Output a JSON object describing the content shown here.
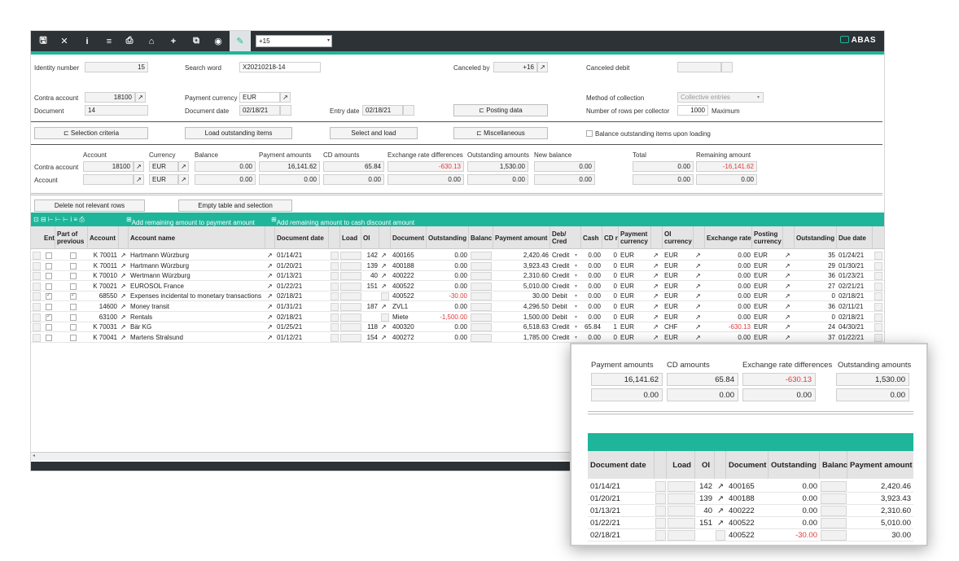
{
  "toolbar": {
    "buttons": [
      {
        "name": "save-icon",
        "glyph": "🖫"
      },
      {
        "name": "close-icon",
        "glyph": "✕"
      },
      {
        "name": "info-icon",
        "glyph": "i"
      },
      {
        "name": "list-icon",
        "glyph": "≡"
      },
      {
        "name": "print-icon",
        "glyph": "⎙"
      },
      {
        "name": "home-icon",
        "glyph": "⌂"
      },
      {
        "name": "add-icon",
        "glyph": "+"
      },
      {
        "name": "copy-icon",
        "glyph": "⧉"
      },
      {
        "name": "view-icon",
        "glyph": "◉"
      },
      {
        "name": "edit-icon",
        "glyph": "✎"
      }
    ],
    "select_value": "+15",
    "brand": "ABAS"
  },
  "header": {
    "identity_label": "Identity number",
    "identity_value": "15",
    "search_label": "Search word",
    "search_value": "X20210218-14",
    "canceled_by_label": "Canceled by",
    "canceled_by_value": "+16",
    "canceled_debit_label": "Canceled debit",
    "contra_label": "Contra account",
    "contra_value": "18100",
    "currency_label": "Payment currency",
    "currency_value": "EUR",
    "method_label": "Method of collection",
    "method_value": "Collective entries",
    "document_label": "Document",
    "document_value": "14",
    "docdate_label": "Document date",
    "docdate_value": "02/18/21",
    "entrydate_label": "Entry date",
    "entrydate_value": "02/18/21",
    "posting_btn": "Posting data",
    "rows_label": "Number of rows per collector",
    "rows_value": "1000",
    "rows_suffix": "Maximum",
    "selection_btn": "Selection criteria",
    "load_btn": "Load outstanding items",
    "select_load_btn": "Select and load",
    "misc_btn": "Miscellaneous",
    "balance_chk": "Balance outstanding items upon loading"
  },
  "summary": {
    "cols": {
      "account": "Account",
      "currency": "Currency",
      "balance": "Balance",
      "payment": "Payment amounts",
      "cd": "CD amounts",
      "exch": "Exchange rate differences",
      "outstanding": "Outstanding amounts",
      "newbal": "New balance",
      "total": "Total",
      "remaining": "Remaining amount"
    },
    "row1_label": "Contra account",
    "row1": {
      "account": "18100",
      "currency": "EUR",
      "balance": "0.00",
      "payment": "16,141.62",
      "cd": "65.84",
      "exch": "-630.13",
      "outstanding": "1,530.00",
      "newbal": "0.00",
      "total": "0.00",
      "remaining": "-16,141.62"
    },
    "row2_label": "Account",
    "row2": {
      "account": "",
      "currency": "EUR",
      "balance": "0.00",
      "payment": "0.00",
      "cd": "0.00",
      "exch": "0.00",
      "outstanding": "0.00",
      "newbal": "0.00",
      "total": "0.00",
      "remaining": "0.00"
    },
    "delete_btn": "Delete not relevant rows",
    "empty_btn": "Empty table and selection"
  },
  "tablebar": {
    "add_payment": "Add remaining amount to payment amount",
    "add_cash": "Add remaining amount to cash discount amount"
  },
  "table": {
    "headers": {
      "ent": "Ente",
      "part": "Part of previous",
      "account": "Account",
      "name": "Account name",
      "docdate": "Document date",
      "load": "Load",
      "oi": "OI",
      "document": "Document",
      "outstanding": "Outstanding",
      "balance": "Balanc",
      "payment": "Payment amount",
      "debcred": "Deb/ Cred",
      "cash": "Cash",
      "cd": "CD r",
      "paycur": "Payment currency",
      "oicur": "OI currency",
      "exch": "Exchange rate",
      "postcur": "Posting currency",
      "outst2": "Outstanding",
      "due": "Due date"
    },
    "rows": [
      {
        "ent": false,
        "part": false,
        "account": "K 70011",
        "name": "Hartmann Würzburg",
        "docdate": "01/14/21",
        "oi": "142",
        "document": "400165",
        "outstanding": "0.00",
        "payment": "2,420.46",
        "debcred": "Credit",
        "cash": "0.00",
        "cd": "0",
        "paycur": "EUR",
        "oicur": "EUR",
        "exch": "0.00",
        "postcur": "EUR",
        "outst2": "35",
        "due": "01/24/21",
        "red_out": false,
        "red_exch": false
      },
      {
        "ent": false,
        "part": false,
        "account": "K 70011",
        "name": "Hartmann Würzburg",
        "docdate": "01/20/21",
        "oi": "139",
        "document": "400188",
        "outstanding": "0.00",
        "payment": "3,923.43",
        "debcred": "Credit",
        "cash": "0.00",
        "cd": "0",
        "paycur": "EUR",
        "oicur": "EUR",
        "exch": "0.00",
        "postcur": "EUR",
        "outst2": "29",
        "due": "01/30/21",
        "red_out": false,
        "red_exch": false
      },
      {
        "ent": false,
        "part": false,
        "account": "K 70010",
        "name": "Wertmann Würzburg",
        "docdate": "01/13/21",
        "oi": "40",
        "document": "400222",
        "outstanding": "0.00",
        "payment": "2,310.60",
        "debcred": "Credit",
        "cash": "0.00",
        "cd": "0",
        "paycur": "EUR",
        "oicur": "EUR",
        "exch": "0.00",
        "postcur": "EUR",
        "outst2": "36",
        "due": "01/23/21",
        "red_out": false,
        "red_exch": false
      },
      {
        "ent": false,
        "part": false,
        "account": "K 70021",
        "name": "EUROSOL France",
        "docdate": "01/22/21",
        "oi": "151",
        "document": "400522",
        "outstanding": "0.00",
        "payment": "5,010.00",
        "debcred": "Credit",
        "cash": "0.00",
        "cd": "0",
        "paycur": "EUR",
        "oicur": "EUR",
        "exch": "0.00",
        "postcur": "EUR",
        "outst2": "27",
        "due": "02/21/21",
        "red_out": false,
        "red_exch": false
      },
      {
        "ent": true,
        "part": true,
        "account": "68550",
        "name": "Expenses incidental to monetary transactions",
        "docdate": "02/18/21",
        "oi": "",
        "document": "400522",
        "outstanding": "-30.00",
        "payment": "30.00",
        "debcred": "Debit",
        "cash": "0.00",
        "cd": "0",
        "paycur": "EUR",
        "oicur": "EUR",
        "exch": "0.00",
        "postcur": "EUR",
        "outst2": "0",
        "due": "02/18/21",
        "red_out": true,
        "red_exch": false
      },
      {
        "ent": false,
        "part": false,
        "account": "14600",
        "name": "Money transit",
        "docdate": "01/31/21",
        "oi": "187",
        "document": "ZVL1",
        "outstanding": "0.00",
        "payment": "4,296.50",
        "debcred": "Debit",
        "cash": "0.00",
        "cd": "0",
        "paycur": "EUR",
        "oicur": "EUR",
        "exch": "0.00",
        "postcur": "EUR",
        "outst2": "36",
        "due": "02/11/21",
        "red_out": false,
        "red_exch": false
      },
      {
        "ent": true,
        "part": false,
        "account": "63100",
        "name": "Rentals",
        "docdate": "02/18/21",
        "oi": "",
        "document": "Miete",
        "outstanding": "-1,500.00",
        "payment": "1,500.00",
        "debcred": "Debit",
        "cash": "0.00",
        "cd": "0",
        "paycur": "EUR",
        "oicur": "EUR",
        "exch": "0.00",
        "postcur": "EUR",
        "outst2": "0",
        "due": "02/18/21",
        "red_out": true,
        "red_exch": false
      },
      {
        "ent": false,
        "part": false,
        "account": "K 70031",
        "name": "Bär KG",
        "docdate": "01/25/21",
        "oi": "118",
        "document": "400320",
        "outstanding": "0.00",
        "payment": "6,518.63",
        "debcred": "Credit",
        "cash": "65.84",
        "cd": "1",
        "paycur": "EUR",
        "oicur": "CHF",
        "exch": "-630.13",
        "postcur": "EUR",
        "outst2": "24",
        "due": "04/30/21",
        "red_out": false,
        "red_exch": true
      },
      {
        "ent": false,
        "part": false,
        "account": "K 70041",
        "name": "Martens Stralsund",
        "docdate": "01/12/21",
        "oi": "154",
        "document": "400272",
        "outstanding": "0.00",
        "payment": "1,785.00",
        "debcred": "Credit",
        "cash": "0.00",
        "cd": "0",
        "paycur": "EUR",
        "oicur": "EUR",
        "exch": "0.00",
        "postcur": "EUR",
        "outst2": "37",
        "due": "01/22/21",
        "red_out": false,
        "red_exch": false
      }
    ]
  },
  "zoom": {
    "payment_label": "Payment amounts",
    "cd_label": "CD amounts",
    "exch_label": "Exchange rate differences",
    "outst_label": "Outstanding amounts",
    "r1": {
      "payment": "16,141.62",
      "cd": "65.84",
      "exch": "-630.13",
      "outst": "1,530.00"
    },
    "r2": {
      "payment": "0.00",
      "cd": "0.00",
      "exch": "0.00",
      "outst": "0.00"
    },
    "headers": {
      "docdate": "Document date",
      "load": "Load",
      "oi": "OI",
      "document": "Document",
      "outstanding": "Outstanding",
      "balance": "Balanc",
      "payment": "Payment amount"
    },
    "rows": [
      {
        "docdate": "01/14/21",
        "oi": "142",
        "document": "400165",
        "outstanding": "0.00",
        "payment": "2,420.46",
        "red": false
      },
      {
        "docdate": "01/20/21",
        "oi": "139",
        "document": "400188",
        "outstanding": "0.00",
        "payment": "3,923.43",
        "red": false
      },
      {
        "docdate": "01/13/21",
        "oi": "40",
        "document": "400222",
        "outstanding": "0.00",
        "payment": "2,310.60",
        "red": false
      },
      {
        "docdate": "01/22/21",
        "oi": "151",
        "document": "400522",
        "outstanding": "0.00",
        "payment": "5,010.00",
        "red": false
      },
      {
        "docdate": "02/18/21",
        "oi": "",
        "document": "400522",
        "outstanding": "-30.00",
        "payment": "30.00",
        "red": true
      }
    ]
  },
  "colors": {
    "accent": "#1fb59a",
    "toolbar": "#2d3236",
    "negative": "#e03a3a"
  }
}
